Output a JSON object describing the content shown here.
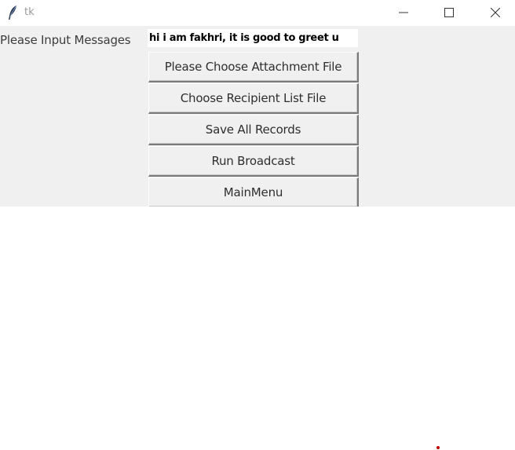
{
  "window": {
    "title": "tk",
    "icon": "feather-icon",
    "controls": {
      "minimize_icon": "minimize-icon",
      "maximize_icon": "maximize-icon",
      "close_icon": "close-icon"
    }
  },
  "form": {
    "message_label": "Please Input Messages",
    "message_value": "hi i am fakhri, it is good to greet u"
  },
  "buttons": {
    "attachment": "Please Choose Attachment File",
    "recipient": "Choose Recipient List File",
    "save": "Save All Records",
    "run": "Run Broadcast",
    "main_menu": "MainMenu"
  },
  "colors": {
    "panel_background": "#f0f0f0",
    "canvas_background": "#ffffff",
    "dot": "#c00000"
  }
}
